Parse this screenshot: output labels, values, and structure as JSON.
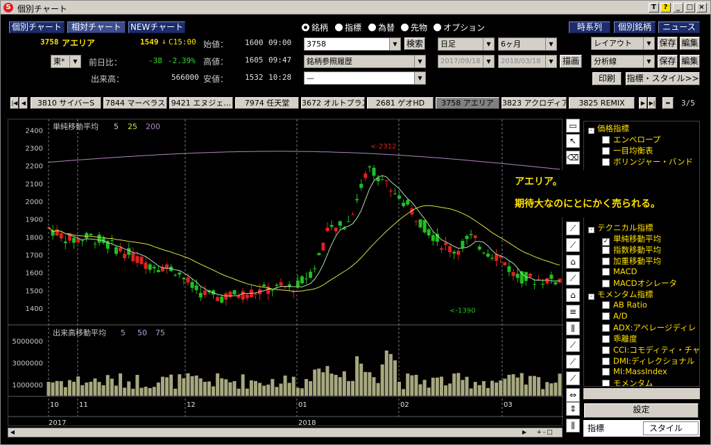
{
  "window": {
    "title": "個別チャート",
    "logo": "S"
  },
  "titlebar_buttons": [
    "T",
    "?",
    "_",
    "□",
    "×"
  ],
  "top_nav": {
    "individual": "個別チャート",
    "relative": "相対チャート",
    "new": "NEWチャート"
  },
  "right_nav": {
    "timeseries": "時系列",
    "individual_stock": "個別銘柄",
    "news": "ニュース"
  },
  "quote": {
    "code": "3758",
    "name": "アエリア",
    "price": "1549",
    "change_mark": "↓",
    "close_time": "C15:00",
    "market": "東*",
    "prev_diff_label": "前日比：",
    "prev_diff": "-38",
    "prev_pct": "-2.39%",
    "volume_label": "出来高：",
    "volume": "566000",
    "open_label": "始値：",
    "open": "1600",
    "open_time": "09:00",
    "high_label": "高値：",
    "high": "1605",
    "high_time": "09:47",
    "low_label": "安値：",
    "low": "1532",
    "low_time": "10:28"
  },
  "radios": [
    {
      "label": "銘柄",
      "selected": true
    },
    {
      "label": "指標",
      "selected": false
    },
    {
      "label": "為替",
      "selected": false
    },
    {
      "label": "先物",
      "selected": false
    },
    {
      "label": "オプション",
      "selected": false
    }
  ],
  "search": {
    "value": "3758",
    "button": "検索",
    "history": "銘柄参照履歴",
    "third": "—"
  },
  "period": {
    "interval": "日足",
    "range": "6ヶ月",
    "from": "2017/09/18",
    "to": "2018/03/18",
    "draw": "描画"
  },
  "panel": {
    "layout": "レイアウト",
    "save1": "保存",
    "edit1": "編集",
    "analysis": "分析線",
    "save2": "保存",
    "edit2": "編集",
    "print": "印刷",
    "style": "指標・スタイル>>"
  },
  "tabs": [
    "3810 サイバーS",
    "7844 マーベラス",
    "9421 エヌジェ…",
    "7974 任天堂",
    "3672 オルトプラス",
    "2681 ゲオHD",
    "3758 アエリア",
    "3823 アクロディア",
    "3825 REMIX"
  ],
  "tab_page": "3/5",
  "chart_data": [
    {
      "type": "candlestick",
      "title": "単純移動平均",
      "ma_periods": [
        "5",
        "25",
        "200"
      ],
      "ma_colors": [
        "#b0e0b0",
        "#e0e040",
        "#b088c0"
      ],
      "y_ticks": [
        1400,
        1500,
        1600,
        1700,
        1800,
        1900,
        2000,
        2100,
        2200,
        2300,
        2400
      ],
      "ylim": [
        1310,
        2460
      ],
      "annotations": [
        {
          "label": "2312",
          "value": 2312
        },
        {
          "label": "1390",
          "value": 1390
        }
      ],
      "up_color": "#e02020",
      "down_color": "#20c020"
    },
    {
      "type": "bar",
      "title": "出来高移動平均",
      "ma_periods": [
        "5",
        "50",
        "75"
      ],
      "y_ticks": [
        1000000,
        3000000,
        5000000
      ],
      "ylim": [
        0,
        6400000
      ],
      "bar_color": "#a8a880"
    }
  ],
  "x_axis": {
    "month_labels": [
      "10",
      "11",
      "12",
      "01",
      "02",
      "03"
    ],
    "year_labels": [
      "2017",
      "2018"
    ]
  },
  "callout": {
    "line1": "アエリア。",
    "line2": "期待大なのにとにかく売られる。"
  },
  "tree": [
    {
      "kind": "group",
      "label": "価格指標"
    },
    {
      "kind": "item",
      "label": "エンベロープ",
      "checked": false
    },
    {
      "kind": "item",
      "label": "一目均衡表",
      "checked": false
    },
    {
      "kind": "item",
      "label": "ボリンジャー・バンド",
      "checked": false
    },
    {
      "kind": "group",
      "label": "テクニカル指標"
    },
    {
      "kind": "item",
      "label": "単純移動平均",
      "checked": true
    },
    {
      "kind": "item",
      "label": "指数移動平均",
      "checked": false
    },
    {
      "kind": "item",
      "label": "加重移動平均",
      "checked": false
    },
    {
      "kind": "item",
      "label": "MACD",
      "checked": false
    },
    {
      "kind": "item",
      "label": "MACDオシレータ",
      "checked": false
    },
    {
      "kind": "group",
      "label": "モメンタム指標"
    },
    {
      "kind": "item",
      "label": "AB Ratio",
      "checked": false
    },
    {
      "kind": "item",
      "label": "A/D",
      "checked": false
    },
    {
      "kind": "item",
      "label": "ADX:アベレージディレ",
      "checked": false
    },
    {
      "kind": "item",
      "label": "乖離度",
      "checked": false
    },
    {
      "kind": "item",
      "label": "CCI:コモディティ・チャ",
      "checked": false
    },
    {
      "kind": "item",
      "label": "DMI:ディレクショナル",
      "checked": false
    },
    {
      "kind": "item",
      "label": "MI:MassIndex",
      "checked": false
    },
    {
      "kind": "item",
      "label": "モメンタム",
      "checked": false
    }
  ],
  "settings_button": "設定",
  "bottom_tabs": {
    "indicator": "指標",
    "style": "スタイル"
  }
}
